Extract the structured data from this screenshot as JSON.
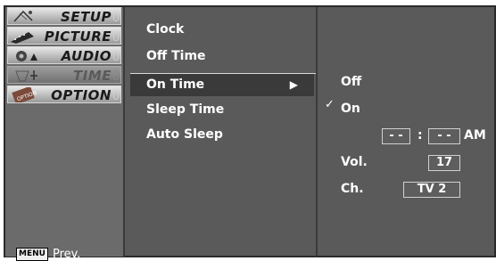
{
  "left_menu": {
    "tabs": [
      {
        "label": "SETUP",
        "icon": "satellite-icon",
        "state": "normal"
      },
      {
        "label": "PICTURE",
        "icon": "film-icon",
        "state": "normal"
      },
      {
        "label": "AUDIO",
        "icon": "speaker-icon",
        "state": "normal"
      },
      {
        "label": "TIME",
        "icon": "clock-icon",
        "state": "selected"
      },
      {
        "label": "OPTION",
        "icon": "option-icon",
        "state": "normal"
      }
    ],
    "menu_button": "MENU",
    "prev_label": "Prev."
  },
  "submenu": {
    "items": [
      {
        "label": "Clock"
      },
      {
        "label": "Off Time"
      },
      {
        "label": "On Time",
        "selected": true,
        "arrow": "▶"
      },
      {
        "label": "Sleep Time"
      },
      {
        "label": "Auto Sleep"
      }
    ]
  },
  "on_time_panel": {
    "options": [
      {
        "label": "Off",
        "checked": false
      },
      {
        "label": "On",
        "checked": true
      }
    ],
    "check_mark": "✓",
    "time": {
      "hour": "- -",
      "separator": ":",
      "minute": "- -",
      "ampm": "AM"
    },
    "vol_label": "Vol.",
    "vol_value": "17",
    "ch_label": "Ch.",
    "ch_value": "TV 2"
  },
  "colors": {
    "panel_bg": "#5a5a5a",
    "selected_row": "#3a3a3a",
    "text": "#ffffff"
  }
}
